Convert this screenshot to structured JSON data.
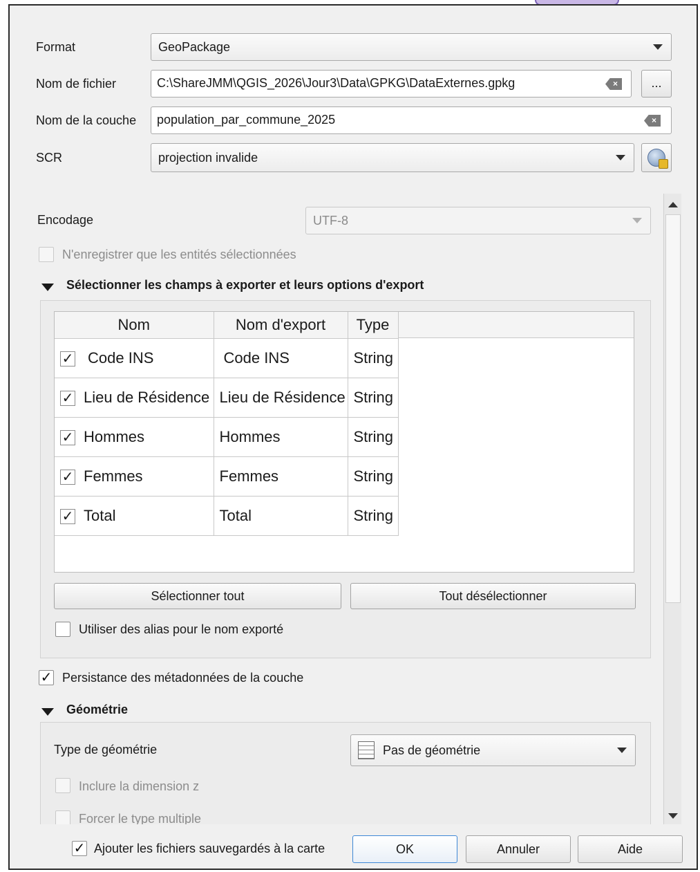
{
  "form": {
    "format_label": "Format",
    "format_value": "GeoPackage",
    "filename_label": "Nom de fichier",
    "filename_value": "C:\\ShareJMM\\QGIS_2026\\Jour3\\Data\\GPKG\\DataExternes.gpkg",
    "browse_label": "...",
    "layer_label": "Nom de la couche",
    "layer_value": "population_par_commune_2025",
    "crs_label": "SCR",
    "crs_value": "projection invalide",
    "encoding_label": "Encodage",
    "encoding_value": "UTF-8",
    "selected_only_label": "N'enregistrer que les entités sélectionnées"
  },
  "fields_section": {
    "title": "Sélectionner les champs à exporter et leurs options d'export",
    "columns": [
      "Nom",
      "Nom d'export",
      "Type"
    ],
    "rows": [
      {
        "checked": true,
        "name": "Code INS",
        "export_name": "Code INS",
        "type": "String"
      },
      {
        "checked": true,
        "name": "Lieu de Résidence",
        "export_name": "Lieu de Résidence",
        "type": "String"
      },
      {
        "checked": true,
        "name": "Hommes",
        "export_name": "Hommes",
        "type": "String"
      },
      {
        "checked": true,
        "name": "Femmes",
        "export_name": "Femmes",
        "type": "String"
      },
      {
        "checked": true,
        "name": "Total",
        "export_name": "Total",
        "type": "String"
      }
    ],
    "select_all_label": "Sélectionner tout",
    "deselect_all_label": "Tout désélectionner",
    "alias_label": "Utiliser des alias pour le nom exporté"
  },
  "metadata_label": "Persistance des métadonnées de la couche",
  "geometry_section": {
    "title": "Géométrie",
    "type_label": "Type de géométrie",
    "type_value": "Pas de géométrie",
    "z_label": "Inclure la dimension z",
    "multi_label": "Forcer le type multiple"
  },
  "footer": {
    "add_to_map_label": "Ajouter les fichiers sauvegardés à la carte",
    "ok_label": "OK",
    "cancel_label": "Annuler",
    "help_label": "Aide"
  },
  "check_mark": "✓"
}
